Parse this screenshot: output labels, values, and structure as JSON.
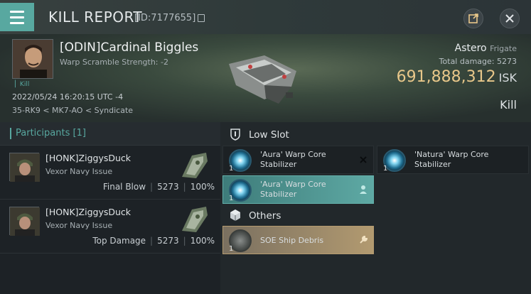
{
  "header": {
    "title": "KILL REPORT",
    "id_text": "[ID:7177655]"
  },
  "victim": {
    "name": "[ODIN]Cardinal Biggles",
    "warp_scramble": "Warp Scramble Strength: -2",
    "kill_tag": "Kill",
    "timestamp": "2022/05/24 16:20:15 UTC -4",
    "location": "35-RK9 < MK7-AO < Syndicate"
  },
  "ship": {
    "name": "Astero",
    "class": "Frigate",
    "total_damage_label": "Total damage:",
    "total_damage": "5273",
    "isk_value": "691,888,312",
    "isk_unit": "ISK",
    "result": "Kill"
  },
  "participants": {
    "header": "Participants [1]",
    "rows": [
      {
        "name": "[HONK]ZiggysDuck",
        "ship": "Vexor Navy Issue",
        "role": "Final Blow",
        "damage": "5273",
        "percent": "100%"
      },
      {
        "name": "[HONK]ZiggysDuck",
        "ship": "Vexor Navy Issue",
        "role": "Top Damage",
        "damage": "5273",
        "percent": "100%"
      }
    ]
  },
  "fittings": {
    "low_slot_title": "Low Slot",
    "others_title": "Others",
    "low_slot": [
      {
        "qty": "1",
        "label": "'Aura' Warp Core Stabilizer",
        "status": "destroyed"
      },
      {
        "qty": "1",
        "label": "'Natura' Warp Core Stabilizer",
        "status": "destroyed"
      },
      {
        "qty": "1",
        "label": "'Aura' Warp Core Stabilizer",
        "status": "dropped"
      }
    ],
    "others": [
      {
        "qty": "1",
        "label": "SOE Ship Debris",
        "status": "dropped"
      }
    ]
  },
  "colors": {
    "accent": "#58a8a0",
    "isk": "#e8c78a",
    "dropped": "#5ea9a4",
    "other_item": "#b29a70"
  }
}
